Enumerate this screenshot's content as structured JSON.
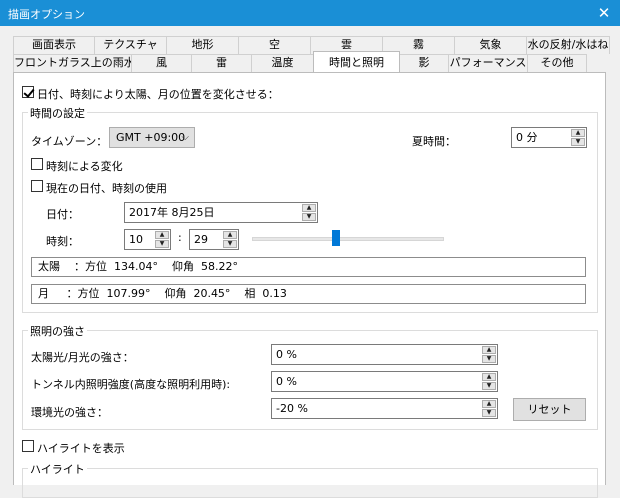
{
  "window": {
    "title": "描画オプション",
    "close_glyph": "✕"
  },
  "tabs_top": [
    "画面表示",
    "テクスチャ",
    "地形",
    "空",
    "雲",
    "霧",
    "気象",
    "水の反射/水はね"
  ],
  "tabs_bottom": [
    "フロントガラス上の雨水",
    "風",
    "雷",
    "温度",
    "時間と照明",
    "影",
    "パフォーマンス",
    "その他"
  ],
  "active_tab": "時間と照明",
  "main_checkbox": {
    "label": "日付、時刻により太陽、月の位置を変化させる：",
    "checked": true
  },
  "time_group": {
    "legend": "時間の設定",
    "timezone_label": "タイムゾーン：",
    "timezone_value": "GMT +09:00",
    "dst_label": "夏時間：",
    "dst_value": "0 分",
    "change_by_time": {
      "label": "時刻による変化",
      "checked": false
    },
    "use_current": {
      "label": "現在の日付、時刻の使用",
      "checked": false
    },
    "date_label": "日付：",
    "date_value": "2017年  8月25日",
    "time_label": "時刻：",
    "hour_value": "10",
    "colon": ":",
    "minute_value": "29",
    "time_slider_fraction": 0.44,
    "sun_info": "太陽    ：方位  134.04°    仰角  58.22°",
    "moon_info": "月     ：方位  107.99°    仰角  20.45°    相  0.13"
  },
  "light_group": {
    "legend": "照明の強さ",
    "sun_moon_label": "太陽光/月光の強さ：",
    "sun_moon_value": "0 %",
    "tunnel_label": "トンネル内照明強度(高度な照明利用時):",
    "tunnel_value": "0 %",
    "ambient_label": "環境光の強さ：",
    "ambient_value": "-20 %",
    "reset_label": "リセット"
  },
  "highlight_checkbox": {
    "label": "ハイライトを表示",
    "checked": false
  },
  "highlight_group": {
    "legend": "ハイライト"
  },
  "colors": {
    "titlebar": "#1a8fd6",
    "slider_thumb": "#0078d7"
  }
}
